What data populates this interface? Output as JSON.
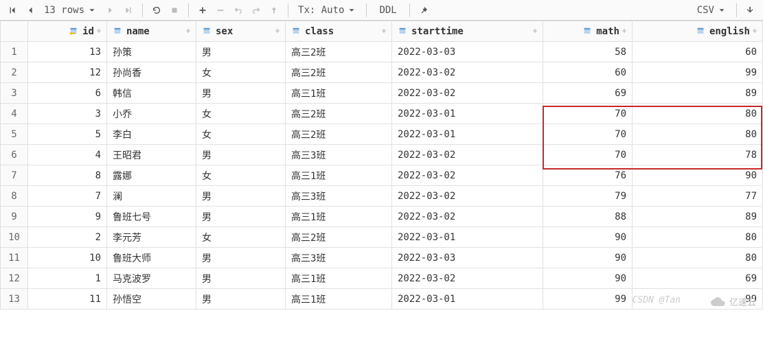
{
  "toolbar": {
    "rows_info": "13 rows",
    "tx_label": "Tx: Auto",
    "ddl_label": "DDL",
    "export_label": "CSV"
  },
  "columns": [
    {
      "key": "id",
      "label": "id",
      "numeric": true,
      "pk": true
    },
    {
      "key": "name",
      "label": "name",
      "numeric": false
    },
    {
      "key": "sex",
      "label": "sex",
      "numeric": false
    },
    {
      "key": "class",
      "label": "class",
      "numeric": false
    },
    {
      "key": "starttime",
      "label": "starttime",
      "numeric": false
    },
    {
      "key": "math",
      "label": "math",
      "numeric": true
    },
    {
      "key": "english",
      "label": "english",
      "numeric": true
    }
  ],
  "rows": [
    {
      "id": 13,
      "name": "孙策",
      "sex": "男",
      "class": "高三2班",
      "starttime": "2022-03-03",
      "math": 58,
      "english": 60
    },
    {
      "id": 12,
      "name": "孙尚香",
      "sex": "女",
      "class": "高三2班",
      "starttime": "2022-03-02",
      "math": 60,
      "english": 99
    },
    {
      "id": 6,
      "name": "韩信",
      "sex": "男",
      "class": "高三1班",
      "starttime": "2022-03-02",
      "math": 69,
      "english": 89
    },
    {
      "id": 3,
      "name": "小乔",
      "sex": "女",
      "class": "高三2班",
      "starttime": "2022-03-01",
      "math": 70,
      "english": 80
    },
    {
      "id": 5,
      "name": "李白",
      "sex": "女",
      "class": "高三2班",
      "starttime": "2022-03-01",
      "math": 70,
      "english": 80
    },
    {
      "id": 4,
      "name": "王昭君",
      "sex": "男",
      "class": "高三3班",
      "starttime": "2022-03-02",
      "math": 70,
      "english": 78
    },
    {
      "id": 8,
      "name": "露娜",
      "sex": "女",
      "class": "高三1班",
      "starttime": "2022-03-02",
      "math": 76,
      "english": 90
    },
    {
      "id": 7,
      "name": "澜",
      "sex": "男",
      "class": "高三3班",
      "starttime": "2022-03-02",
      "math": 79,
      "english": 77
    },
    {
      "id": 9,
      "name": "鲁班七号",
      "sex": "男",
      "class": "高三1班",
      "starttime": "2022-03-02",
      "math": 88,
      "english": 89
    },
    {
      "id": 2,
      "name": "李元芳",
      "sex": "女",
      "class": "高三2班",
      "starttime": "2022-03-01",
      "math": 90,
      "english": 80
    },
    {
      "id": 10,
      "name": "鲁班大师",
      "sex": "男",
      "class": "高三3班",
      "starttime": "2022-03-03",
      "math": 90,
      "english": 80
    },
    {
      "id": 1,
      "name": "马克波罗",
      "sex": "男",
      "class": "高三1班",
      "starttime": "2022-03-02",
      "math": 90,
      "english": 69
    },
    {
      "id": 11,
      "name": "孙悟空",
      "sex": "男",
      "class": "高三1班",
      "starttime": "2022-03-01",
      "math": 99,
      "english": 99
    }
  ],
  "watermark": {
    "csdn": "CSDN @Tan",
    "yisu": "亿速云"
  }
}
